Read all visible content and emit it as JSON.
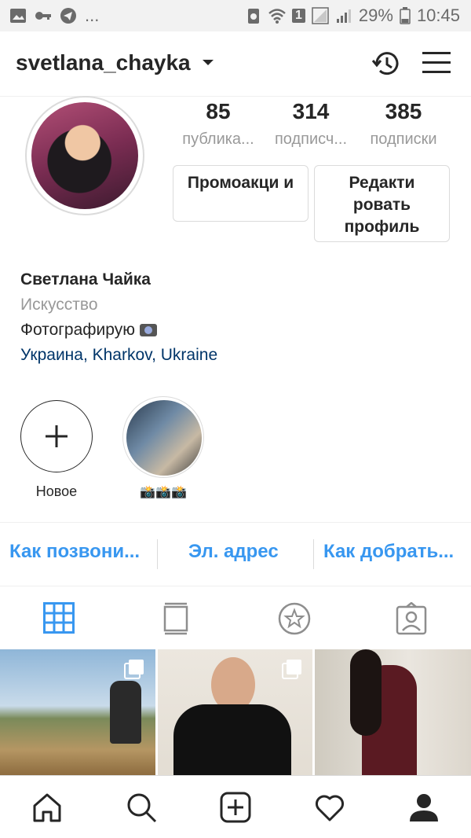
{
  "status_bar": {
    "battery": "29%",
    "time": "10:45",
    "notification_count": "1",
    "more_indicator": "..."
  },
  "header": {
    "username": "svetlana_chayka"
  },
  "stats": [
    {
      "value": "85",
      "label": "публика..."
    },
    {
      "value": "314",
      "label": "подписч..."
    },
    {
      "value": "385",
      "label": "подписки"
    }
  ],
  "buttons": {
    "promo": "Промоакци и",
    "edit_profile": "Редакти ровать профиль"
  },
  "bio": {
    "full_name": "Светлана Чайка",
    "category": "Искусство",
    "description": "Фотографирую",
    "location": "Украина, Kharkov, Ukraine"
  },
  "highlights": [
    {
      "label": "Новое"
    },
    {
      "label": "📸📸📸"
    }
  ],
  "contacts": {
    "call": "Как позвони...",
    "email": "Эл. адрес",
    "directions": "Как добрать..."
  },
  "colors": {
    "link_blue": "#3897f0",
    "location_blue": "#003569",
    "text_dark": "#262626",
    "text_gray": "#999999"
  }
}
